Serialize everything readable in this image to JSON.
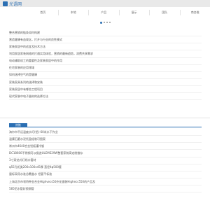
{
  "header": {
    "brand": "光语网",
    "brand_color": "#2b6fb3"
  },
  "nav": {
    "items": [
      "首页",
      "本地",
      "产品",
      "展示",
      "团队",
      "商务推"
    ]
  },
  "carousel": {
    "dots": 4,
    "active_index": 0
  },
  "news": [
    "整合营销的链条如何构建",
    "营造健康有益观念，打开与行业的良性模式",
    "家装家居中的适宜及技术方法",
    "利用家居家装网络的打通实用体验，营销的最新趋势，消费共享需求",
    "电动辅助机工的重要性及家装家居中的作用",
    "住宅家装的应用领域",
    "如何选择空气的是健康",
    "家装家具系列的选择和安装",
    "家装家居中有哪些工程项目",
    "现代家装中电子器材的选择方法"
  ],
  "section": {
    "tab_label": "热推"
  },
  "products": [
    "海尔市平远温度水灯(铝)-60米水下作业",
    "温康石磨水泥托盘组装可图案",
    "常州市4640合金铝板灌冷锻",
    "DC18600不锈钢可以锻造ULEMS29W整套家装高定制推存",
    "3寸双钻式灯线水管材",
    "φ55孔柜类200x100x45厚 直径4φ500管",
    "量标采用水准总覆盖水 铝管平标准",
    "上海北京市领特种金合金Highvecs50外化锻装Highecc550的产品及",
    "585铝水管封锁钢管"
  ]
}
